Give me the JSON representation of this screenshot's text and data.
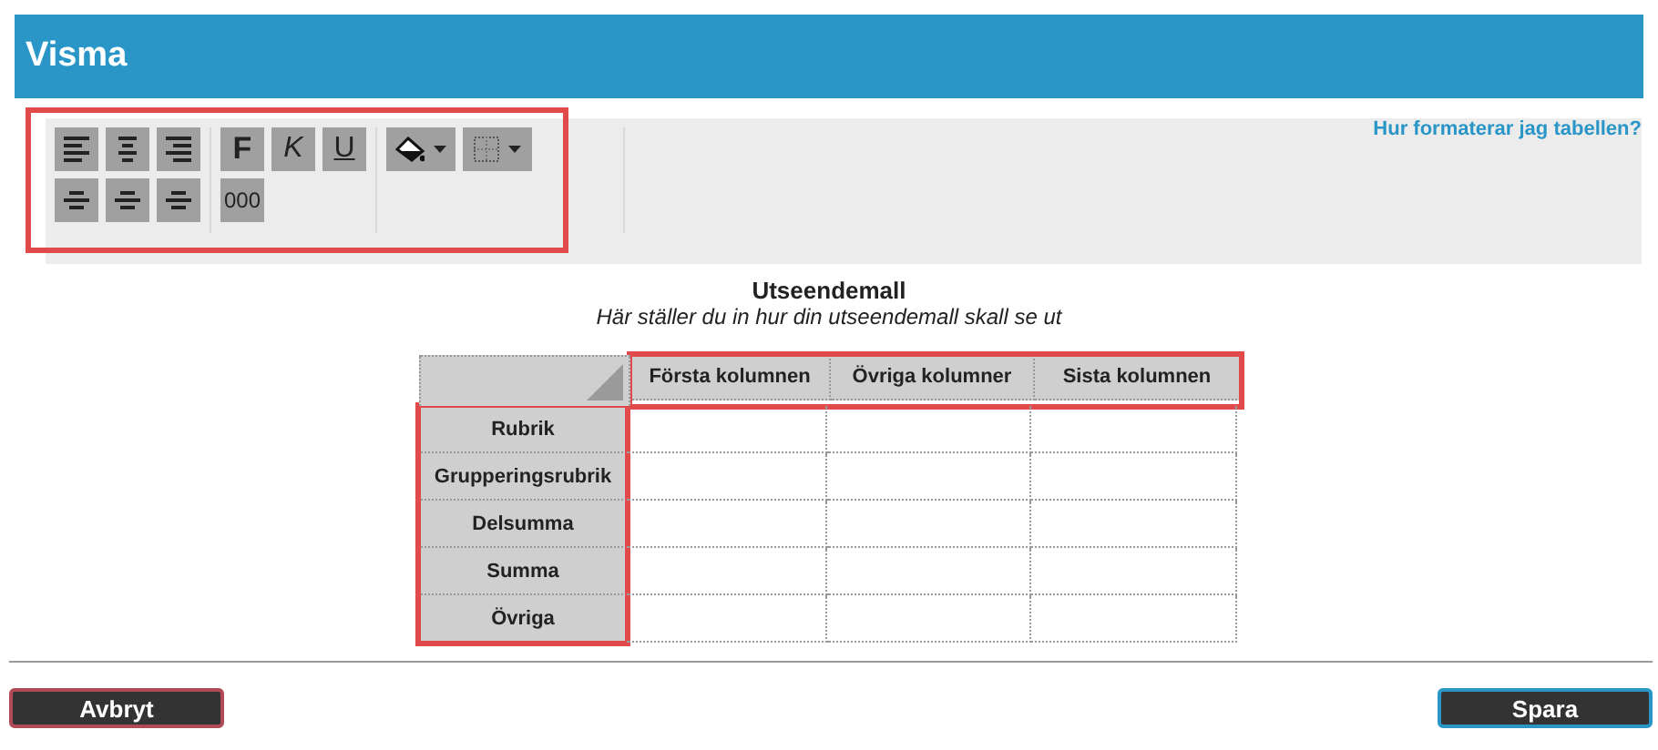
{
  "window": {
    "title": "Visma"
  },
  "toolbar": {
    "highlighted": true,
    "align_buttons": [
      {
        "kind": "h-left"
      },
      {
        "kind": "h-center"
      },
      {
        "kind": "h-right"
      },
      {
        "kind": "v-top"
      },
      {
        "kind": "v-middle"
      },
      {
        "kind": "v-bottom"
      }
    ],
    "style_buttons": [
      {
        "kind": "bold",
        "label": "F"
      },
      {
        "kind": "italic",
        "label": "K"
      },
      {
        "kind": "underline",
        "label": "U"
      },
      {
        "kind": "number",
        "label": "000"
      }
    ],
    "color_buttons": [
      {
        "kind": "fill"
      },
      {
        "kind": "border"
      }
    ],
    "help_link": "Hur formaterar jag tabellen?"
  },
  "template": {
    "title": "Utseendemall",
    "subtitle": "Här ställer du in hur din utseendemall skall se ut",
    "header_highlighted": true,
    "rowheads_highlighted": true,
    "columns": [
      "Första kolumnen",
      "Övriga kolumner",
      "Sista kolumnen"
    ],
    "rows": [
      "Rubrik",
      "Grupperingsrubrik",
      "Delsumma",
      "Summa",
      "Övriga"
    ]
  },
  "buttons": [
    {
      "kind": "cancel",
      "label": "Avbryt"
    },
    {
      "kind": "save",
      "label": "Spara"
    }
  ]
}
